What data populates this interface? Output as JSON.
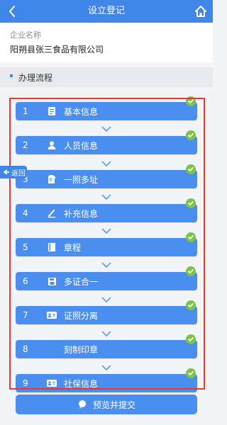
{
  "header": {
    "title": "设立登记"
  },
  "company": {
    "label": "企业名称",
    "name": "阳朔县张三食品有限公司"
  },
  "section": {
    "title": "办理流程"
  },
  "side_tab": {
    "label": "返回"
  },
  "steps": [
    {
      "num": "1",
      "label": "基本信息",
      "icon": "document-icon",
      "completed": true
    },
    {
      "num": "2",
      "label": "人员信息",
      "icon": "person-icon",
      "completed": true
    },
    {
      "num": "3",
      "label": "一照多址",
      "icon": "clipboard-icon",
      "completed": true
    },
    {
      "num": "4",
      "label": "补充信息",
      "icon": "pen-icon",
      "completed": true
    },
    {
      "num": "5",
      "label": "章程",
      "icon": "book-icon",
      "completed": true
    },
    {
      "num": "6",
      "label": "多证合一",
      "icon": "save-icon",
      "completed": true
    },
    {
      "num": "7",
      "label": "证照分离",
      "icon": "id-card-icon",
      "completed": true
    },
    {
      "num": "8",
      "label": "刻制印章",
      "icon": "",
      "completed": true
    },
    {
      "num": "9",
      "label": "社保信息",
      "icon": "id-card-icon",
      "completed": true
    }
  ],
  "submit": {
    "label": "预览并提交",
    "icon": "chat-icon"
  },
  "colors": {
    "primary": "#4a8ff0",
    "header": "#3f86e8",
    "check": "#7cc34a",
    "frame": "#e53935"
  }
}
